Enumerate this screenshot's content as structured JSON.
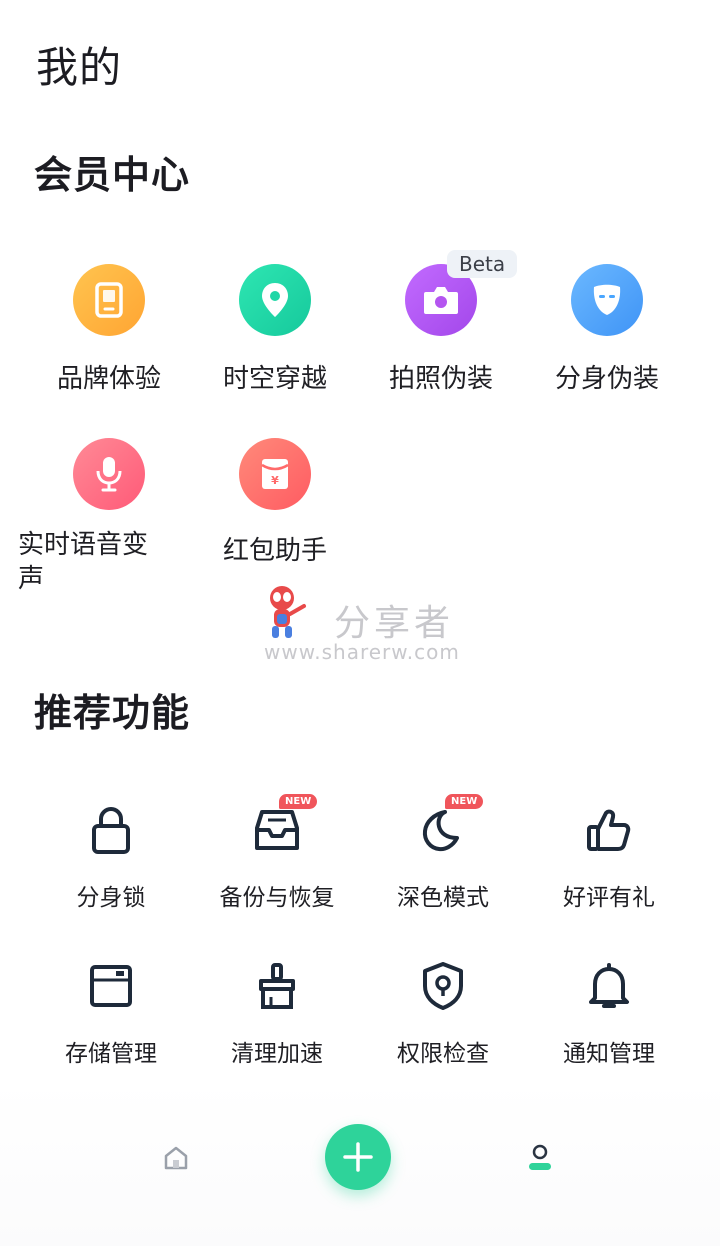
{
  "page": {
    "title": "我的"
  },
  "member_center": {
    "title": "会员中心",
    "beta_badge": "Beta",
    "items": [
      {
        "label": "品牌体验",
        "icon": "phone-icon",
        "color": "#ffb43c"
      },
      {
        "label": "时空穿越",
        "icon": "location-pin-icon",
        "color": "#1fd6a6"
      },
      {
        "label": "拍照伪装",
        "icon": "camera-icon",
        "color": "#b455f0"
      },
      {
        "label": "分身伪装",
        "icon": "mask-icon",
        "color": "#4aa6ff"
      },
      {
        "label": "实时语音变声",
        "icon": "microphone-icon",
        "color": "#ff6e86"
      },
      {
        "label": "红包助手",
        "icon": "red-envelope-icon",
        "color": "#ff6a6a"
      }
    ]
  },
  "recommended": {
    "title": "推荐功能",
    "new_badge": "NEW",
    "items": [
      {
        "label": "分身锁",
        "icon": "lock-icon"
      },
      {
        "label": "备份与恢复",
        "icon": "inbox-backup-icon"
      },
      {
        "label": "深色模式",
        "icon": "moon-icon"
      },
      {
        "label": "好评有礼",
        "icon": "thumbs-up-icon"
      },
      {
        "label": "存储管理",
        "icon": "storage-box-icon"
      },
      {
        "label": "清理加速",
        "icon": "broom-icon"
      },
      {
        "label": "权限检查",
        "icon": "shield-pin-icon"
      },
      {
        "label": "通知管理",
        "icon": "bell-icon"
      }
    ]
  },
  "watermark": {
    "text": "分享者",
    "url": "www.sharerw.com"
  },
  "bottom_nav": {
    "home": "home-icon",
    "add": "plus-icon",
    "profile": "profile-icon",
    "accent": "#2ed39a"
  }
}
